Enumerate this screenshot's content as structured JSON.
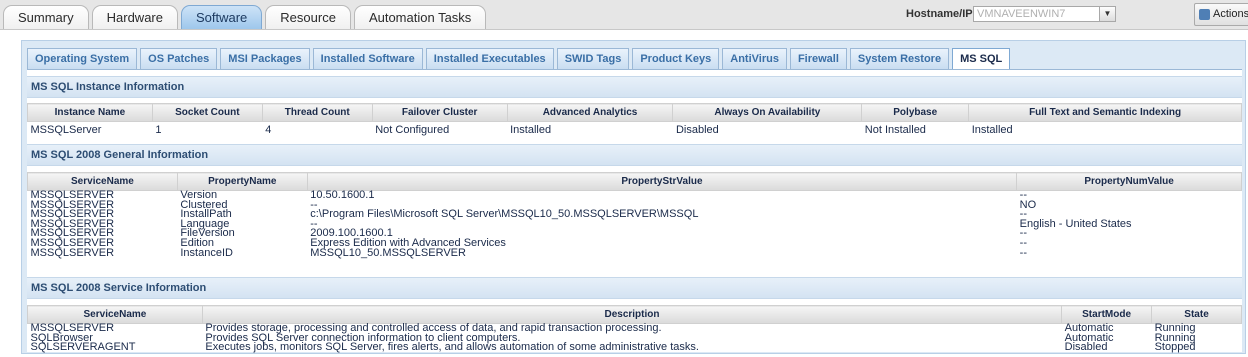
{
  "main_tabs": [
    {
      "label": "Summary"
    },
    {
      "label": "Hardware"
    },
    {
      "label": "Software"
    },
    {
      "label": "Resource"
    },
    {
      "label": "Automation Tasks"
    }
  ],
  "host": {
    "label": "Hostname/IP",
    "value": "VMNAVEENWIN7"
  },
  "action_label": "Actions",
  "sub_tabs": [
    {
      "label": "Operating System"
    },
    {
      "label": "OS Patches"
    },
    {
      "label": "MSI Packages"
    },
    {
      "label": "Installed Software"
    },
    {
      "label": "Installed Executables"
    },
    {
      "label": "SWID Tags"
    },
    {
      "label": "Product Keys"
    },
    {
      "label": "AntiVirus"
    },
    {
      "label": "Firewall"
    },
    {
      "label": "System Restore"
    },
    {
      "label": "MS SQL"
    }
  ],
  "instance": {
    "title": "MS SQL Instance Information",
    "headers": [
      "Instance Name",
      "Socket Count",
      "Thread Count",
      "Failover Cluster",
      "Advanced Analytics",
      "Always On Availability",
      "Polybase",
      "Full Text and Semantic Indexing"
    ],
    "rows": [
      [
        "MSSQLServer",
        "1",
        "4",
        "Not Configured",
        "Installed",
        "Disabled",
        "Not Installed",
        "Installed"
      ]
    ]
  },
  "general": {
    "title": "MS SQL 2008 General Information",
    "headers": [
      "ServiceName",
      "PropertyName",
      "PropertyStrValue",
      "PropertyNumValue"
    ],
    "rows": [
      [
        "MSSQLSERVER",
        "Version",
        "10.50.1600.1",
        "--"
      ],
      [
        "MSSQLSERVER",
        "Clustered",
        "--",
        "NO"
      ],
      [
        "MSSQLSERVER",
        "InstallPath",
        "c:\\Program Files\\Microsoft SQL Server\\MSSQL10_50.MSSQLSERVER\\MSSQL",
        "--"
      ],
      [
        "MSSQLSERVER",
        "Language",
        "--",
        "English - United States"
      ],
      [
        "MSSQLSERVER",
        "FileVersion",
        "2009.100.1600.1",
        "--"
      ],
      [
        "MSSQLSERVER",
        "Edition",
        "Express Edition with Advanced Services",
        "--"
      ],
      [
        "MSSQLSERVER",
        "InstanceID",
        "MSSQL10_50.MSSQLSERVER",
        "--"
      ]
    ]
  },
  "service": {
    "title": "MS SQL 2008 Service Information",
    "headers": [
      "ServiceName",
      "Description",
      "StartMode",
      "State"
    ],
    "rows": [
      [
        "MSSQLSERVER",
        "Provides storage, processing and controlled access of data, and rapid transaction processing.",
        "Automatic",
        "Running"
      ],
      [
        "SQLBrowser",
        "Provides SQL Server connection information to client computers.",
        "Automatic",
        "Running"
      ],
      [
        "SQLSERVERAGENT",
        "Executes jobs, monitors SQL Server, fires alerts, and allows automation of some administrative tasks.",
        "Disabled",
        "Stopped"
      ]
    ]
  }
}
